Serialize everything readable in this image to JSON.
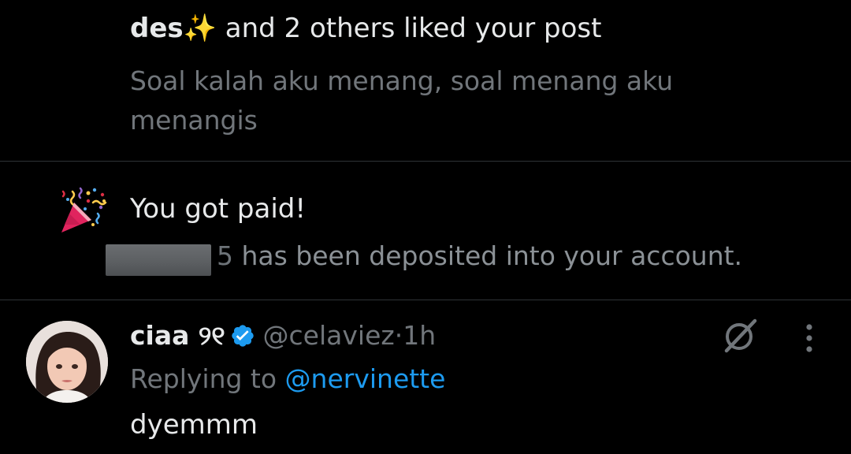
{
  "like_notification": {
    "actor_name": "des✨",
    "action_text": " and 2 others liked your post",
    "post_preview": "Soal kalah aku menang, soal menang aku menangis"
  },
  "paid_notification": {
    "icon": "party-popper-icon",
    "title": "You got paid!",
    "amount_partial": "5",
    "detail_text": " has been deposited into your account."
  },
  "reply_tweet": {
    "display_name": "ciaa ୨୧",
    "verified": true,
    "handle": "@celaviez",
    "separator": " · ",
    "time": "1h",
    "replying_prefix": "Replying to ",
    "replying_handle": "@nervinette",
    "text": "dyemmm",
    "icons": [
      "avatar",
      "verified-badge-icon",
      "grok-icon",
      "more-options-icon"
    ]
  },
  "colors": {
    "background": "#000000",
    "primary_text": "#e7e9ea",
    "secondary_text": "#71767b",
    "accent": "#1d9bf0",
    "divider": "#2f3336"
  }
}
